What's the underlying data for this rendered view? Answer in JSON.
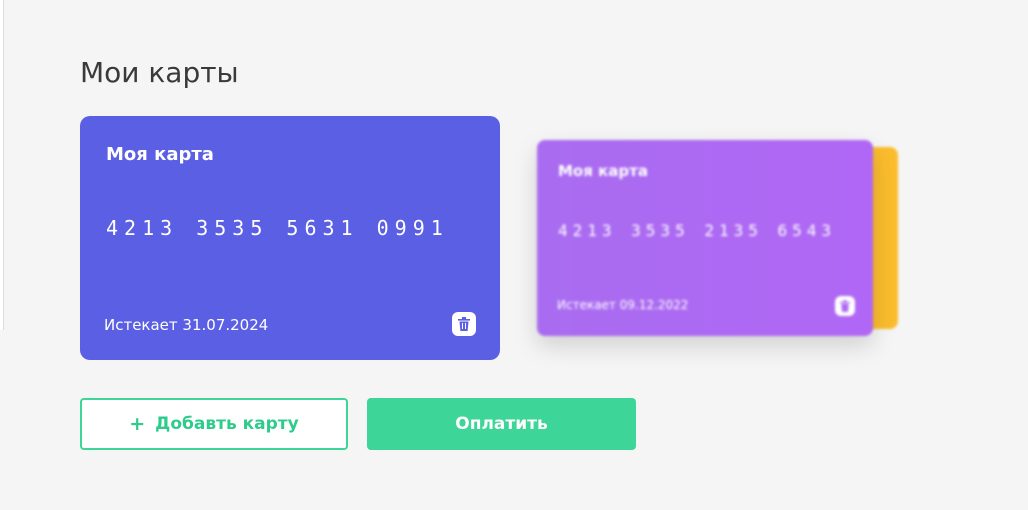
{
  "page": {
    "title": "Мои карты"
  },
  "cards": [
    {
      "name": "Моя карта",
      "number": "4213 3535 5631 0991",
      "expiry": "Истекает 31.07.2024",
      "color": "#5b5fe3"
    },
    {
      "name": "Моя карта",
      "number": "4213 3535 2135 6543",
      "expiry": "Истекает 09.12.2022",
      "color": "#ad6af2"
    }
  ],
  "stack_back_card": {
    "color": "#fbbd2d"
  },
  "icons": {
    "delete": "trash-icon",
    "add": "plus-icon"
  },
  "actions": {
    "add_plus": "+",
    "add_label": "Добавть карту",
    "pay_label": "Оплатить"
  },
  "colors": {
    "accent": "#3dd598",
    "background": "#f5f5f5"
  }
}
